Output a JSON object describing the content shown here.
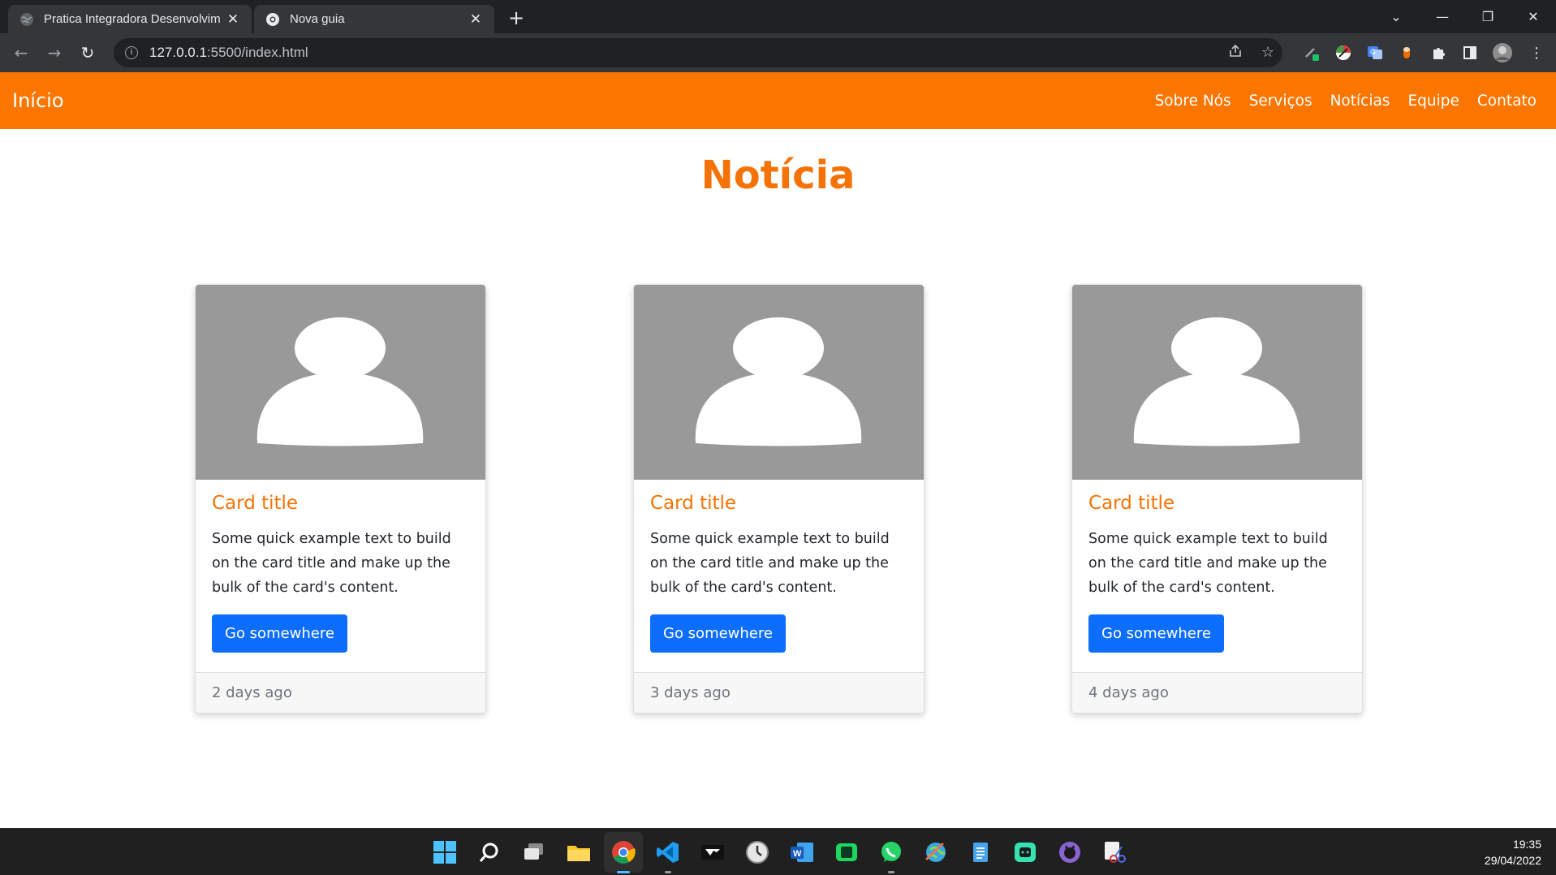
{
  "browser": {
    "tabs": [
      {
        "title": "Pratica Integradora Desenvolvim",
        "close": "✕"
      },
      {
        "title": "Nova guia",
        "close": "✕"
      }
    ],
    "new_tab": "+",
    "url_host": "127.0.0.1",
    "url_rest": ":5500/index.html",
    "window_controls": [
      "⌄",
      "—",
      "❐",
      "✕"
    ],
    "nav_icons": {
      "back": "←",
      "forward": "→",
      "reload": "↻"
    }
  },
  "navbar": {
    "brand": "Início",
    "links": [
      "Sobre Nós",
      "Serviços",
      "Notícias",
      "Equipe",
      "Contato"
    ],
    "color": "#fb7600"
  },
  "main": {
    "heading": "Notícia",
    "cards": [
      {
        "title": "Card title",
        "text": "Some quick example text to build on the card title and make up the bulk of the card's content.",
        "button": "Go somewhere",
        "footer": "2 days ago"
      },
      {
        "title": "Card title",
        "text": "Some quick example text to build on the card title and make up the bulk of the card's content.",
        "button": "Go somewhere",
        "footer": "3 days ago"
      },
      {
        "title": "Card title",
        "text": "Some quick example text to build on the card title and make up the bulk of the card's content.",
        "button": "Go somewhere",
        "footer": "4 days ago"
      }
    ],
    "accent": "#f57206",
    "button_color": "#0d6efd"
  },
  "taskbar": {
    "time": "19:35",
    "date": "29/04/2022",
    "apps": [
      "windows-start",
      "search",
      "task-view",
      "file-explorer",
      "chrome",
      "vscode",
      "terminal-app",
      "clock-app",
      "word",
      "android-studio",
      "whatsapp",
      "browser-globe",
      "notepad",
      "bot-app",
      "github-desktop",
      "snipping-tool"
    ]
  }
}
